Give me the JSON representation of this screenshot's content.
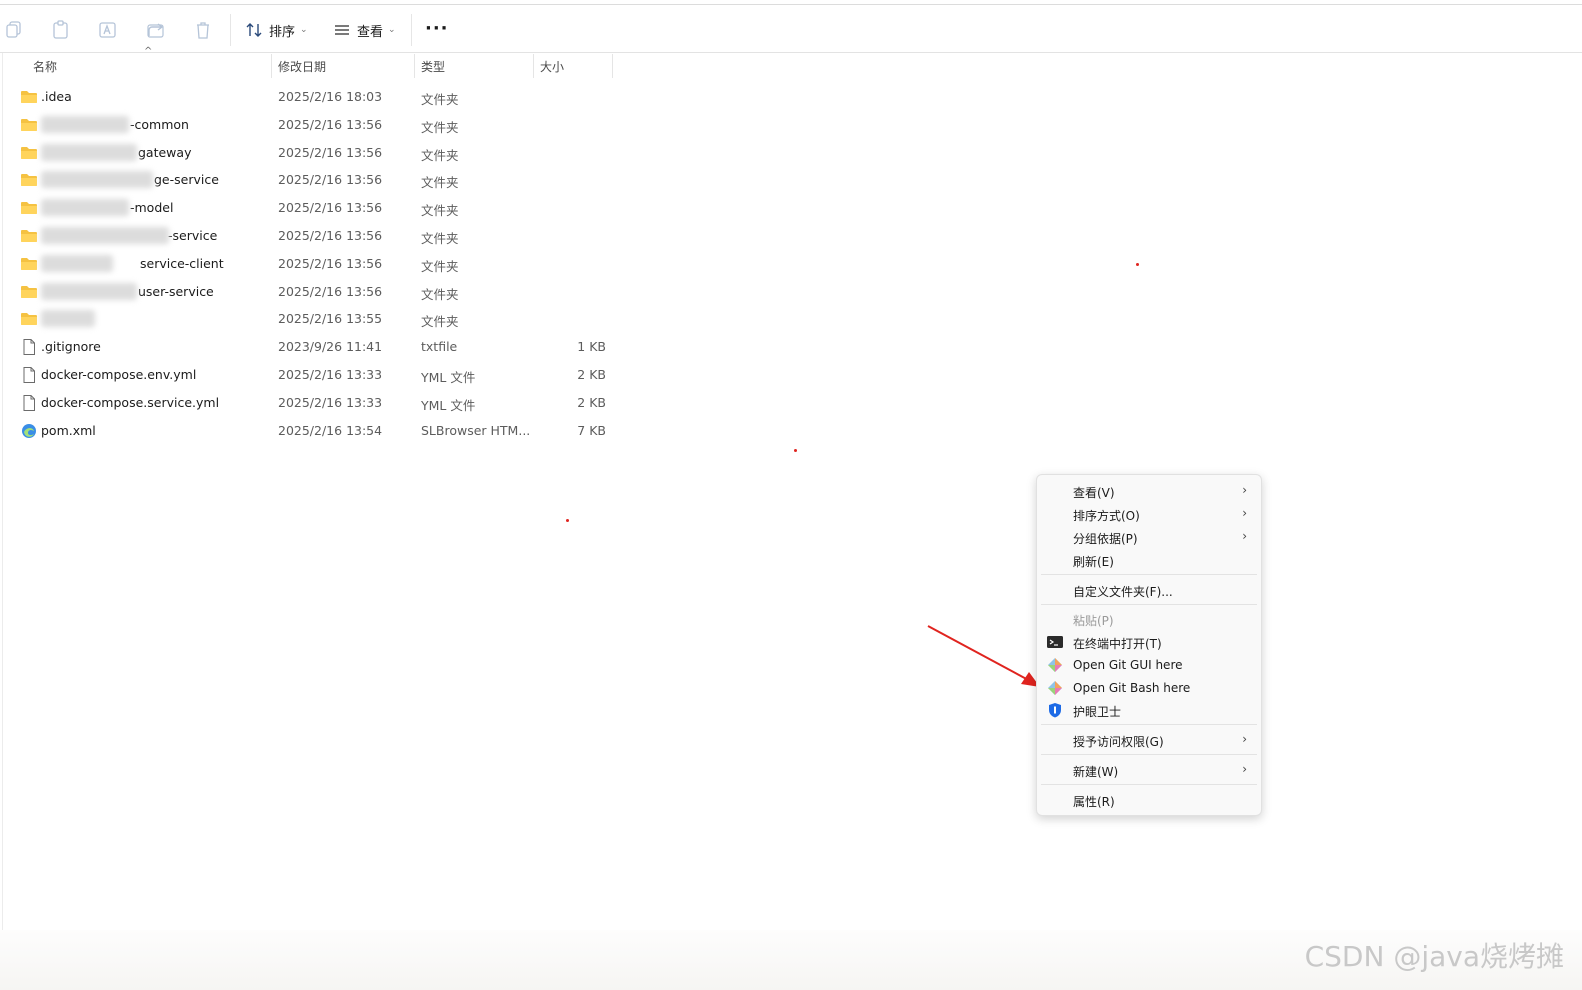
{
  "toolbar": {
    "sort_label": "排序",
    "view_label": "查看",
    "more_label": "···",
    "icons": [
      "copy-icon",
      "paste-icon",
      "rename-icon",
      "share-icon",
      "delete-icon",
      "sort-icon",
      "view-icon"
    ]
  },
  "columns": {
    "name": "名称",
    "date": "修改日期",
    "type": "类型",
    "size": "大小"
  },
  "files": [
    {
      "name": ".idea",
      "date": "2025/2/16 18:03",
      "type": "文件夹",
      "size": "",
      "icon": "folder-icon"
    },
    {
      "name": "-common",
      "date": "2025/2/16 13:56",
      "type": "文件夹",
      "size": "",
      "icon": "folder-icon"
    },
    {
      "name": "gateway",
      "date": "2025/2/16 13:56",
      "type": "文件夹",
      "size": "",
      "icon": "folder-icon"
    },
    {
      "name": "ge-service",
      "date": "2025/2/16 13:56",
      "type": "文件夹",
      "size": "",
      "icon": "folder-icon"
    },
    {
      "name": "-model",
      "date": "2025/2/16 13:56",
      "type": "文件夹",
      "size": "",
      "icon": "folder-icon"
    },
    {
      "name": "-service",
      "date": "2025/2/16 13:56",
      "type": "文件夹",
      "size": "",
      "icon": "folder-icon"
    },
    {
      "name": "service-client",
      "date": "2025/2/16 13:56",
      "type": "文件夹",
      "size": "",
      "icon": "folder-icon"
    },
    {
      "name": "user-service",
      "date": "2025/2/16 13:56",
      "type": "文件夹",
      "size": "",
      "icon": "folder-icon"
    },
    {
      "name": "",
      "date": "2025/2/16 13:55",
      "type": "文件夹",
      "size": "",
      "icon": "folder-icon"
    },
    {
      "name": ".gitignore",
      "date": "2023/9/26 11:41",
      "type": "txtfile",
      "size": "1 KB",
      "icon": "file-icon"
    },
    {
      "name": "docker-compose.env.yml",
      "date": "2025/2/16 13:33",
      "type": "YML 文件",
      "size": "2 KB",
      "icon": "file-icon"
    },
    {
      "name": "docker-compose.service.yml",
      "date": "2025/2/16 13:33",
      "type": "YML 文件",
      "size": "2 KB",
      "icon": "file-icon"
    },
    {
      "name": "pom.xml",
      "date": "2025/2/16 13:54",
      "type": "SLBrowser HTM...",
      "size": "7 KB",
      "icon": "browser-file-icon"
    }
  ],
  "context_menu": {
    "view": "查看(V)",
    "sort_by": "排序方式(O)",
    "group_by": "分组依据(P)",
    "refresh": "刷新(E)",
    "customize": "自定义文件夹(F)...",
    "paste": "粘贴(P)",
    "open_terminal": "在终端中打开(T)",
    "git_gui": "Open Git GUI here",
    "git_bash": "Open Git Bash here",
    "eye_guard": "护眼卫士",
    "grant_access": "授予访问权限(G)",
    "new": "新建(W)",
    "properties": "属性(R)"
  },
  "watermark": "CSDN @java烧烤摊",
  "colors": {
    "folder": "#f5c242",
    "arrow": "#e0241f",
    "menu_bg": "#f9f9f9"
  }
}
